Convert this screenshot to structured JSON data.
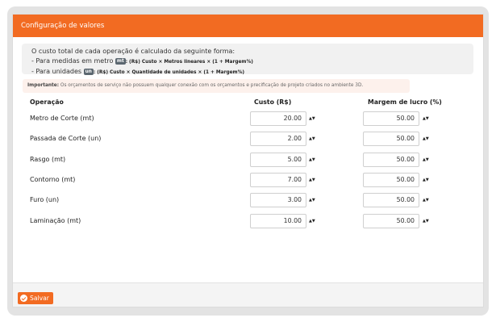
{
  "panel": {
    "title": "Configuração de valores"
  },
  "info": {
    "line1": "O custo total de cada operação é calculado da seguinte forma:",
    "line2_prefix": "- Para medidas em metro",
    "line2_tag": "mt",
    "line2_formula": ": (R$) Custo × Metros lineares × (1 + Margem%)",
    "line3_prefix": "- Para unidades",
    "line3_tag": "un",
    "line3_formula": ": (R$) Custo × Quantidade de unidades × (1 + Margem%)"
  },
  "note": {
    "label": "Importante:",
    "text": "Os orçamentos de serviço não possuem qualquer conexão com os orçamentos e precificação de projeto criados no ambiente 3D."
  },
  "table": {
    "headers": {
      "operacao": "Operação",
      "custo": "Custo (R$)",
      "margem": "Margem de lucro (%)"
    },
    "rows": [
      {
        "label": "Metro de Corte (mt)",
        "custo": "20.00",
        "margem": "50.00"
      },
      {
        "label": "Passada de Corte (un)",
        "custo": "2.00",
        "margem": "50.00"
      },
      {
        "label": "Rasgo (mt)",
        "custo": "5.00",
        "margem": "50.00"
      },
      {
        "label": "Contorno (mt)",
        "custo": "7.00",
        "margem": "50.00"
      },
      {
        "label": "Furo (un)",
        "custo": "3.00",
        "margem": "50.00"
      },
      {
        "label": "Laminação (mt)",
        "custo": "10.00",
        "margem": "50.00"
      }
    ],
    "spinner_glyphs": "▲▼"
  },
  "footer": {
    "save_label": "Salvar"
  },
  "colors": {
    "accent": "#f26b22",
    "tag_bg": "#5b6770",
    "note_bg": "#fdf1ec"
  },
  "icons": {
    "save": "check-circle-icon",
    "spinner": "stepper-arrows-icon"
  }
}
